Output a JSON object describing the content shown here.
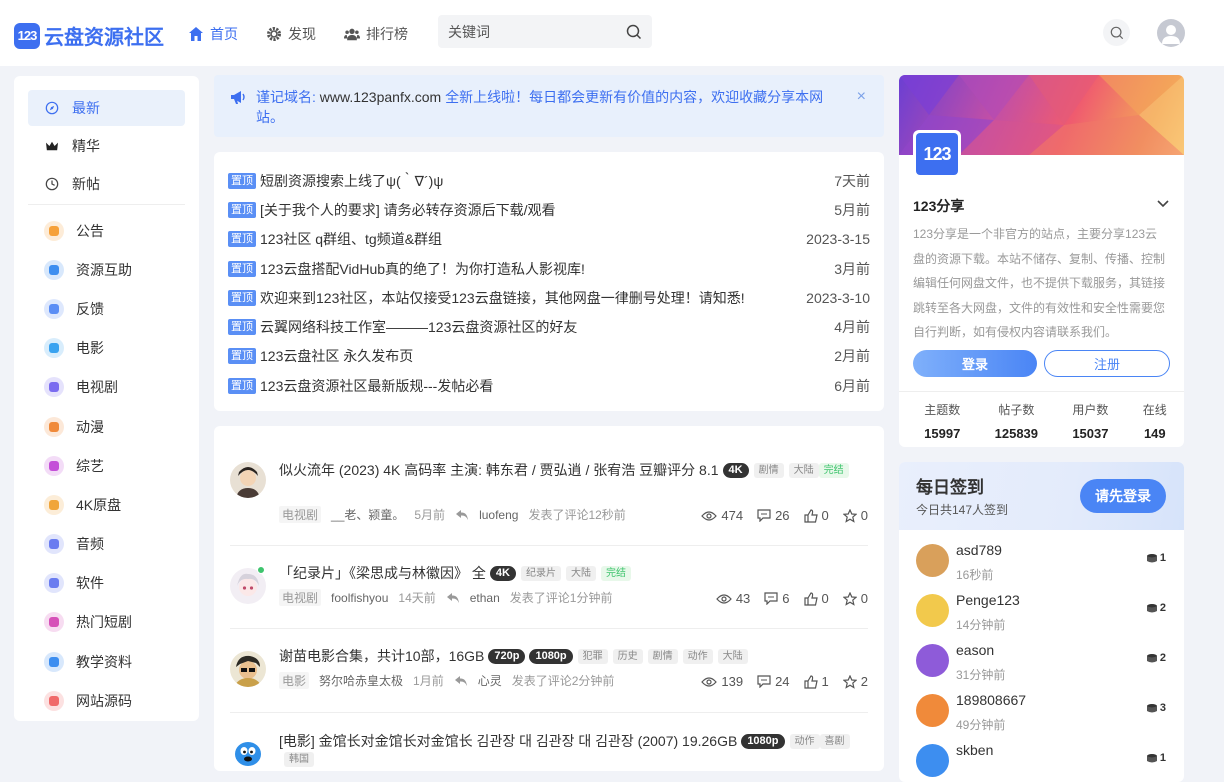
{
  "header": {
    "logo_badge": "123",
    "logo_text": "云盘资源社区",
    "nav": [
      {
        "label": "首页",
        "icon": "home-icon"
      },
      {
        "label": "发现",
        "icon": "gear-icon"
      },
      {
        "label": "排行榜",
        "icon": "users-icon"
      }
    ],
    "search_placeholder": "关键词"
  },
  "sidebar": {
    "main": [
      {
        "label": "最新",
        "icon": "compass-icon"
      },
      {
        "label": "精华",
        "icon": "crown-icon"
      },
      {
        "label": "新帖",
        "icon": "clock-icon"
      }
    ],
    "categories": [
      {
        "label": "公告",
        "color": "#f6a13a",
        "icon": "megaphone-icon"
      },
      {
        "label": "资源互助",
        "color": "#3d8ef0",
        "icon": "exchange-icon"
      },
      {
        "label": "反馈",
        "color": "#5b8ef5",
        "icon": "feedback-icon"
      },
      {
        "label": "电影",
        "color": "#3aa3f0",
        "icon": "movie-icon"
      },
      {
        "label": "电视剧",
        "color": "#7b6cf0",
        "icon": "tv-icon"
      },
      {
        "label": "动漫",
        "color": "#f08a3a",
        "icon": "anime-icon"
      },
      {
        "label": "综艺",
        "color": "#c44fd8",
        "icon": "variety-icon"
      },
      {
        "label": "4K原盘",
        "color": "#f0a53a",
        "icon": "4k-icon"
      },
      {
        "label": "音频",
        "color": "#6a7cf0",
        "icon": "music-icon"
      },
      {
        "label": "软件",
        "color": "#6a7cf0",
        "icon": "apps-icon"
      },
      {
        "label": "热门短剧",
        "color": "#d650b8",
        "icon": "short-drama-icon"
      },
      {
        "label": "教学资料",
        "color": "#3d8ef0",
        "icon": "graduation-icon"
      },
      {
        "label": "网站源码",
        "color": "#f06a6a",
        "icon": "code-icon"
      }
    ]
  },
  "notice": {
    "prefix": "谨记域名: ",
    "domain": "www.123panfx.com",
    "text": " 全新上线啦！每日都会更新有价值的内容，欢迎收藏分享本网站。",
    "close": "×"
  },
  "pinned": {
    "tag": "置顶",
    "items": [
      {
        "title": "短剧资源搜索上线了ψ(｀∇´)ψ",
        "time": "7天前"
      },
      {
        "title": "[关于我个人的要求] 请务必转存资源后下载/观看",
        "time": "5月前"
      },
      {
        "title": "123社区 q群组、tg频道&群组",
        "time": "2023-3-15"
      },
      {
        "title": "123云盘搭配VidHub真的绝了！为你打造私人影视库!",
        "time": "3月前"
      },
      {
        "title": "欢迎来到123社区，本站仅接受123云盘链接，其他网盘一律删号处理！请知悉!",
        "time": "2023-3-10"
      },
      {
        "title": "云翼网络科技工作室———123云盘资源社区的好友",
        "time": "4月前"
      },
      {
        "title": "123云盘社区 永久发布页",
        "time": "2月前"
      },
      {
        "title": "123云盘资源社区最新版规---发帖必看",
        "time": "6月前"
      }
    ]
  },
  "posts": [
    {
      "title": "似火流年 (2023) 4K 高码率 主演: 韩东君 / 贾弘逍 / 张宥浩 豆瓣评分 8.1",
      "dark_badges": [
        "4K"
      ],
      "light_badges": [
        "剧情",
        "大陆"
      ],
      "green_badges": [
        "完结"
      ],
      "category": "电视剧",
      "author": "__老、颍童。",
      "posted": "5月前",
      "replier": "luofeng",
      "action": "发表了评论",
      "replied": "12秒前",
      "views": "474",
      "comments": "26",
      "likes": "0",
      "stars": "0"
    },
    {
      "title": "「纪录片」《梁思成与林徽因》 全",
      "dark_badges": [
        "4K"
      ],
      "light_badges": [
        "纪录片",
        "大陆"
      ],
      "green_badges": [
        "完结"
      ],
      "category": "电视剧",
      "author": "foolfishyou",
      "posted": "14天前",
      "replier": "ethan",
      "action": "发表了评论",
      "replied": "1分钟前",
      "views": "43",
      "comments": "6",
      "likes": "0",
      "stars": "0"
    },
    {
      "title": "谢苗电影合集，共计10部，16GB",
      "dark_badges": [
        "720p",
        "1080p"
      ],
      "light_badges": [
        "犯罪",
        "历史",
        "剧情",
        "动作",
        "大陆"
      ],
      "green_badges": [],
      "category": "电影",
      "author": "努尔哈赤皇太极",
      "posted": "1月前",
      "replier": "心灵",
      "action": "发表了评论",
      "replied": "2分钟前",
      "views": "139",
      "comments": "24",
      "likes": "1",
      "stars": "2"
    },
    {
      "title": "[电影] 金馆长对金馆长对金馆长 김관장 대 김관장 대 김관장 (2007) 19.26GB",
      "dark_badges": [
        "1080p"
      ],
      "light_badges": [
        "动作",
        "喜剧",
        "韩国"
      ],
      "green_badges": []
    }
  ],
  "profile": {
    "logo": "123",
    "name": "123分享",
    "desc": "123分享是一个非官方的站点，主要分享123云盘的资源下载。本站不储存、复制、传播、控制编辑任何网盘文件，也不提供下载服务，其链接跳转至各大网盘，文件的有效性和安全性需要您自行判断，如有侵权内容请联系我们。",
    "login": "登录",
    "register": "注册",
    "stats": [
      {
        "label": "主题数",
        "value": "15997"
      },
      {
        "label": "帖子数",
        "value": "125839"
      },
      {
        "label": "用户数",
        "value": "15037"
      },
      {
        "label": "在线",
        "value": "149"
      }
    ]
  },
  "checkin": {
    "title": "每日签到",
    "subtitle": "今日共147人签到",
    "button": "请先登录",
    "users": [
      {
        "name": "asd789",
        "time": "16秒前",
        "count": "1",
        "avatar_color": "#d9a05b"
      },
      {
        "name": "Penge123",
        "time": "14分钟前",
        "count": "2",
        "avatar_color": "#f2c94c"
      },
      {
        "name": "eason",
        "time": "31分钟前",
        "count": "2",
        "avatar_color": "#8e5bd9"
      },
      {
        "name": "189808667",
        "time": "49分钟前",
        "count": "3",
        "avatar_color": "#f08a3a"
      },
      {
        "name": "skben",
        "time": "",
        "count": "1",
        "avatar_color": "#3d8ef0"
      }
    ]
  }
}
